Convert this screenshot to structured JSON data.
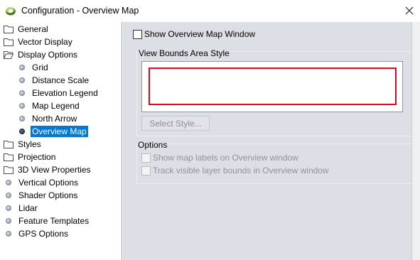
{
  "window": {
    "title": "Configuration - Overview Map",
    "close_icon": "close-icon"
  },
  "tree": {
    "items": [
      {
        "label": "General",
        "icon": "folder-icon",
        "level": 0
      },
      {
        "label": "Vector Display",
        "icon": "folder-icon",
        "level": 0
      },
      {
        "label": "Display Options",
        "icon": "folder-open-icon",
        "level": 0
      },
      {
        "label": "Grid",
        "icon": "bullet-icon",
        "level": 1
      },
      {
        "label": "Distance Scale",
        "icon": "bullet-icon",
        "level": 1
      },
      {
        "label": "Elevation Legend",
        "icon": "bullet-icon",
        "level": 1
      },
      {
        "label": "Map Legend",
        "icon": "bullet-icon",
        "level": 1
      },
      {
        "label": "North Arrow",
        "icon": "bullet-icon",
        "level": 1
      },
      {
        "label": "Overview Map",
        "icon": "bullet-icon",
        "level": 1,
        "selected": true
      },
      {
        "label": "Styles",
        "icon": "folder-icon",
        "level": 0
      },
      {
        "label": "Projection",
        "icon": "folder-icon",
        "level": 0
      },
      {
        "label": "3D View Properties",
        "icon": "folder-icon",
        "level": 0
      },
      {
        "label": "Vertical Options",
        "icon": "bullet-icon",
        "level": 0
      },
      {
        "label": "Shader Options",
        "icon": "bullet-icon",
        "level": 0
      },
      {
        "label": "Lidar",
        "icon": "bullet-icon",
        "level": 0
      },
      {
        "label": "Feature Templates",
        "icon": "bullet-icon",
        "level": 0
      },
      {
        "label": "GPS Options",
        "icon": "bullet-icon",
        "level": 0
      }
    ]
  },
  "panel": {
    "show_overview_label": "Show Overview Map Window",
    "show_overview_checked": false,
    "view_bounds_title": "View Bounds Area Style",
    "bounds_style_color": "#e3061a",
    "select_style_label": "Select Style...",
    "options_title": "Options",
    "option_show_labels": "Show map labels on Overview window",
    "option_track_bounds": "Track visible layer bounds in Overview window"
  },
  "colors": {
    "selection": "#0078d7",
    "panel_bg": "#dcdfe5"
  }
}
